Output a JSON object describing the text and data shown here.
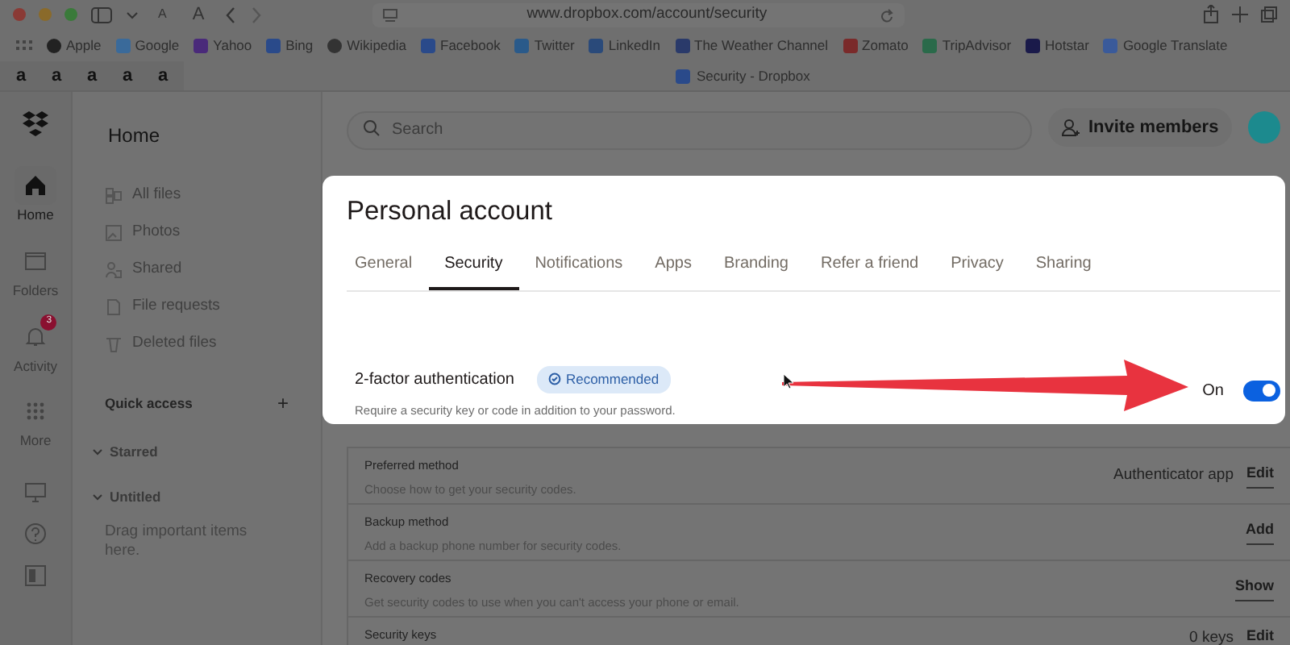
{
  "browser": {
    "font_buttons": [
      "A",
      "A"
    ],
    "url": "www.dropbox.com/account/security",
    "bookmarks": [
      {
        "label": "Apple"
      },
      {
        "label": "Google"
      },
      {
        "label": "Yahoo"
      },
      {
        "label": "Bing"
      },
      {
        "label": "Wikipedia"
      },
      {
        "label": "Facebook"
      },
      {
        "label": "Twitter"
      },
      {
        "label": "LinkedIn"
      },
      {
        "label": "The Weather Channel"
      },
      {
        "label": "Zomato"
      },
      {
        "label": "TripAdvisor"
      },
      {
        "label": "Hotstar"
      },
      {
        "label": "Google Translate"
      }
    ],
    "pinned_tabs": [
      "a",
      "a",
      "a",
      "a",
      "a"
    ],
    "active_tab": "Security - Dropbox"
  },
  "rail": {
    "items": [
      {
        "kind": "home",
        "label": "Home",
        "selected": true
      },
      {
        "kind": "folders",
        "label": "Folders",
        "selected": false
      },
      {
        "kind": "activity",
        "label": "Activity",
        "selected": false,
        "badge": "3"
      },
      {
        "kind": "more",
        "label": "More",
        "selected": false
      }
    ]
  },
  "sidebar": {
    "title": "Home",
    "items": [
      {
        "kind": "files",
        "label": "All files"
      },
      {
        "kind": "photos",
        "label": "Photos"
      },
      {
        "kind": "shared",
        "label": "Shared"
      },
      {
        "kind": "requests",
        "label": "File requests"
      },
      {
        "kind": "deleted",
        "label": "Deleted files"
      }
    ],
    "quick_access": "Quick access",
    "add": "+",
    "sections": [
      {
        "label": "Starred",
        "expanded": true
      },
      {
        "label": "Untitled",
        "expanded": true
      }
    ],
    "hint": "Drag important items here."
  },
  "search": {
    "placeholder": "Search"
  },
  "invite_button": "Invite members",
  "panel": {
    "title": "Personal account",
    "tabs": [
      {
        "label": "General",
        "selected": false
      },
      {
        "label": "Security",
        "selected": true
      },
      {
        "label": "Notifications",
        "selected": false
      },
      {
        "label": "Apps",
        "selected": false
      },
      {
        "label": "Branding",
        "selected": false
      },
      {
        "label": "Refer a friend",
        "selected": false
      },
      {
        "label": "Privacy",
        "selected": false
      },
      {
        "label": "Sharing",
        "selected": false
      }
    ],
    "setting": {
      "label": "2-factor authentication",
      "badge": "Recommended",
      "description": "Require a security key or code in addition to your password.",
      "state_label": "On",
      "on": true
    }
  },
  "rows": [
    {
      "title": "Preferred method",
      "description": "Choose how to get your security codes.",
      "value": "Authenticator app",
      "action": "Edit"
    },
    {
      "title": "Backup method",
      "description": "Add a backup phone number for security codes.",
      "action": "Add"
    },
    {
      "title": "Recovery codes",
      "description": "Get security codes to use when you can't access your phone or email.",
      "action": "Show"
    },
    {
      "title": "Security keys",
      "value": "0 keys",
      "action": "Edit"
    }
  ]
}
